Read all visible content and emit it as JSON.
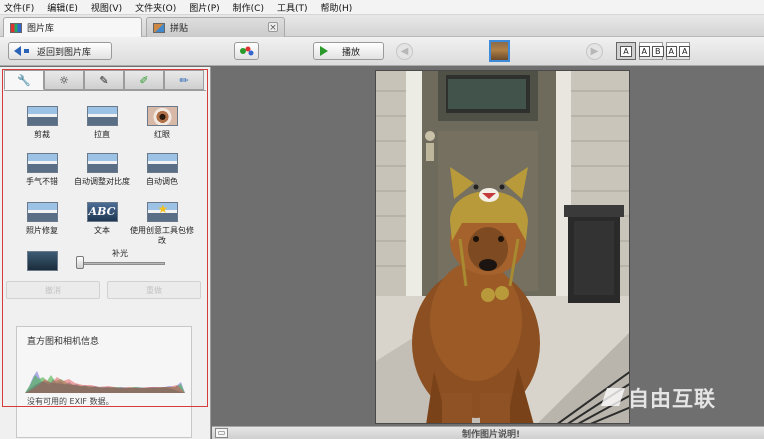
{
  "menu": [
    "文件(F)",
    "编辑(E)",
    "视图(V)",
    "文件夹(O)",
    "图片(P)",
    "制作(C)",
    "工具(T)",
    "帮助(H)"
  ],
  "tabs": {
    "library": "图片库",
    "collage": "拼贴",
    "close_glyph": "×"
  },
  "toolbar": {
    "back_label": "返回到图片库",
    "play_label": "播放",
    "prev_glyph": "◀",
    "next_glyph": "▶",
    "view_single": "A",
    "view_double": [
      "A",
      "B"
    ],
    "view_compare": [
      "A",
      "A"
    ]
  },
  "panel_tabs": [
    {
      "icon": "wrench-icon",
      "glyph": "🔧"
    },
    {
      "icon": "sun-icon",
      "glyph": "☼"
    },
    {
      "icon": "brush-icon",
      "glyph": "✎"
    },
    {
      "icon": "green-brush-icon",
      "glyph": "✐"
    },
    {
      "icon": "blue-brush-icon",
      "glyph": "✏"
    }
  ],
  "fixes": [
    {
      "label": "剪裁",
      "icon": "crop-icon"
    },
    {
      "label": "拉直",
      "icon": "straighten-icon"
    },
    {
      "label": "红眼",
      "icon": "red-eye-icon"
    },
    {
      "label": "手气不错",
      "icon": "feeling-lucky-icon"
    },
    {
      "label": "自动调整对比度",
      "icon": "auto-contrast-icon"
    },
    {
      "label": "自动调色",
      "icon": "auto-color-icon"
    },
    {
      "label": "照片修复",
      "icon": "retouch-icon"
    },
    {
      "label": "文本",
      "icon": "text-icon"
    },
    {
      "label": "使用创意工具包修改",
      "icon": "creative-kit-icon"
    }
  ],
  "fill_light": {
    "label": "补光",
    "value": 0
  },
  "undo_label": "撤消",
  "redo_label": "重做",
  "histogram": {
    "title": "直方图和相机信息",
    "note": "没有可用的 EXIF 数据。"
  },
  "caption_placeholder": "制作图片说明!",
  "caption_toggle_glyph": "▭",
  "text_icon_glyph": "ABC",
  "watermark_text": "自由互联",
  "colors": {
    "selection_border": "#d63b3b",
    "canvas_bg": "#6f6f6f",
    "accent_blue": "#2a63b8",
    "play_green": "#2a9a2a"
  }
}
